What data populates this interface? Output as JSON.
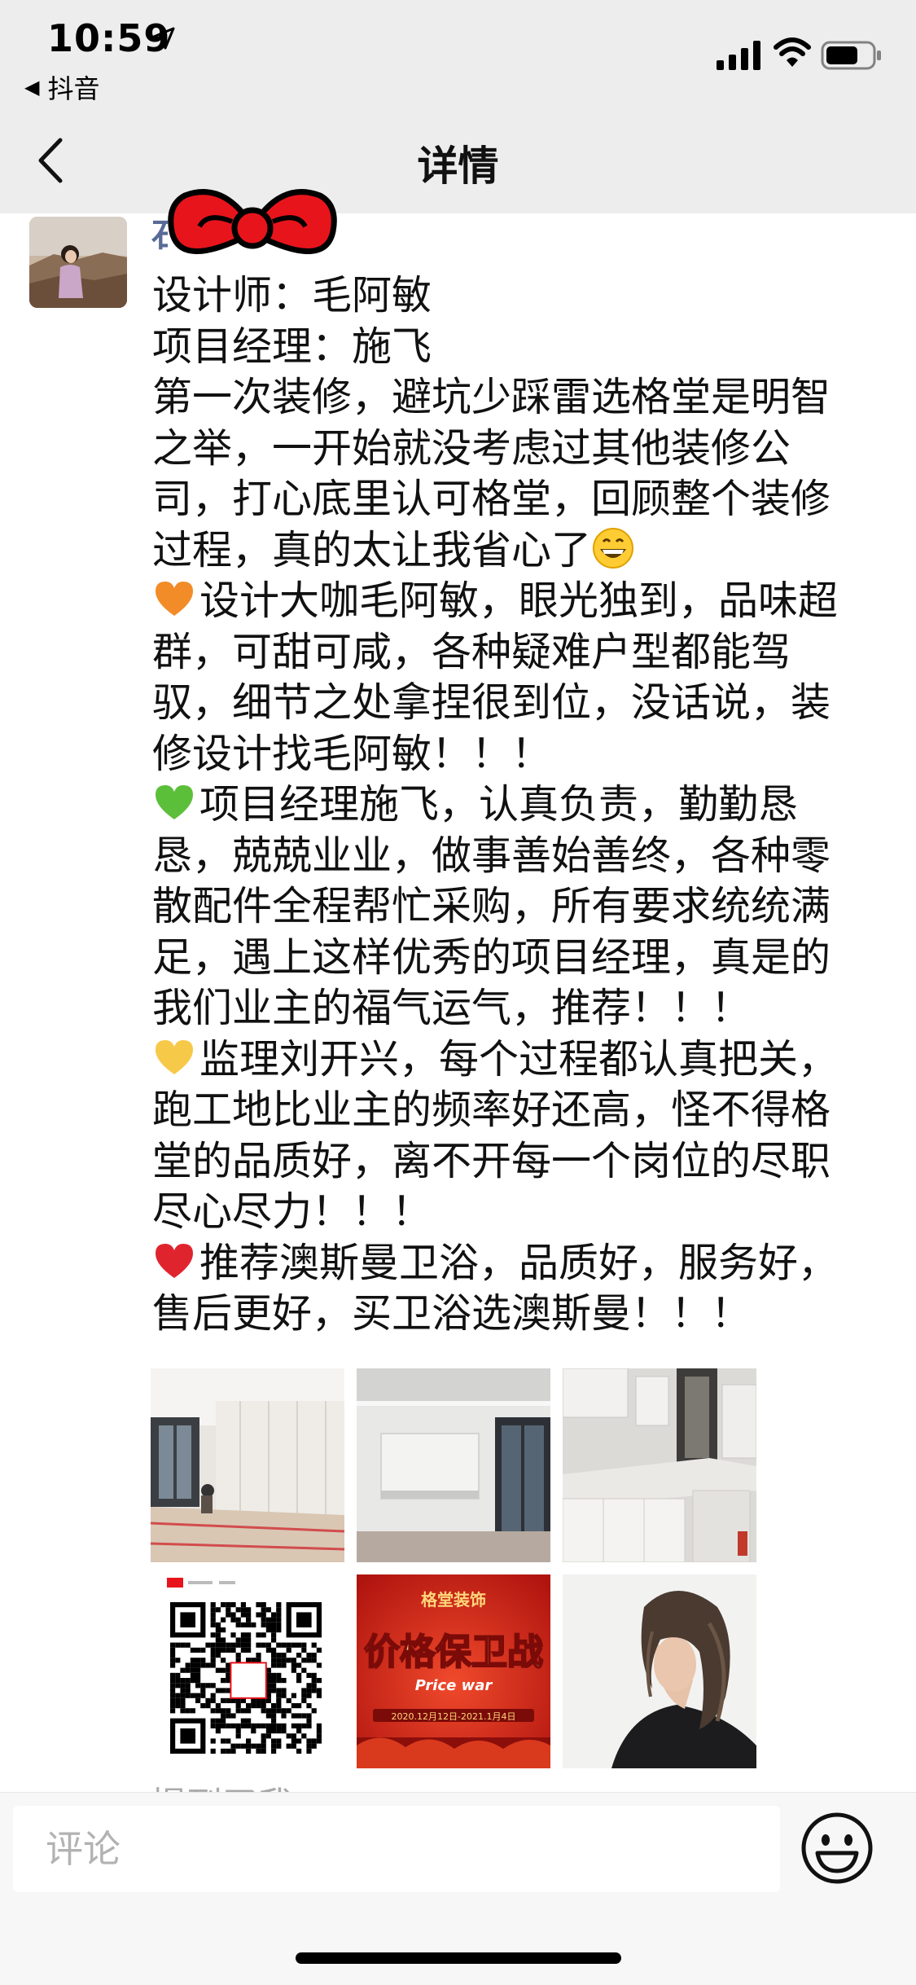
{
  "status_bar": {
    "time": "10:59",
    "back_app_label": "抖音"
  },
  "nav": {
    "title": "详情"
  },
  "post": {
    "author_initial": "石",
    "lines": [
      "设计师：毛阿敏",
      "项目经理：施飞",
      "第一次装修，避坑少踩雷选格堂是明智",
      "之举，一开始就没考虑过其他装修公",
      "司，打心底里认可格堂，回顾整个装修",
      "过程，真的太让我省心了",
      "设计大咖毛阿敏，眼光独到，品味超",
      "群，可甜可咸，各种疑难户型都能驾",
      "驭，细节之处拿捏很到位，没话说，装",
      "修设计找毛阿敏！！！",
      "项目经理施飞，认真负责，勤勤恳",
      "恳，兢兢业业，做事善始善终，各种零",
      "散配件全程帮忙采购，所有要求统统满",
      "足，遇上这样优秀的项目经理，真是的",
      "我们业主的福气运气，推荐！！！",
      "监理刘开兴，每个过程都认真把关，",
      "跑工地比业主的频率好还高，怪不得格",
      "堂的品质好，离不开每一个岗位的尽职",
      "尽心尽力！！！",
      "推荐澳斯曼卫浴，品质好，服务好，",
      "售后更好，买卫浴选澳斯曼！！！"
    ],
    "emojis": {
      "grin": "grinning-face-emoji",
      "orange_heart": "orange-heart-emoji",
      "green_heart": "green-heart-emoji",
      "yellow_heart": "yellow-heart-emoji",
      "red_heart": "red-heart-emoji"
    },
    "mention_partial": "提到了我"
  },
  "grid": {
    "poster_brand": "格堂装饰",
    "poster_title": "价格保卫战",
    "poster_subtitle": "Price war",
    "poster_dates": "2020.12月12日-2021.1月4日"
  },
  "comment": {
    "placeholder": "评论"
  },
  "colors": {
    "header_bg": "#ededed",
    "link_blue": "#576b95",
    "poster_red": "#d92b1f",
    "poster_gold": "#ffd77a",
    "bow_red": "#e8141c"
  }
}
